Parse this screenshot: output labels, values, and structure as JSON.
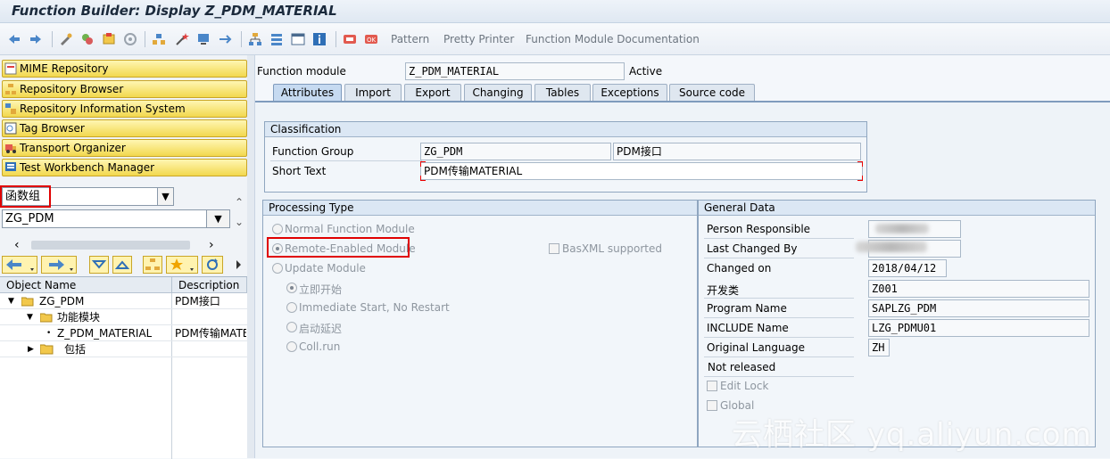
{
  "window": {
    "title": "Function Builder: Display Z_PDM_MATERIAL"
  },
  "toolbar": {
    "pattern_label": "Pattern",
    "pretty_printer_label": "Pretty Printer",
    "fm_docs_label": "Function Module Documentation"
  },
  "nav": {
    "buttons": [
      "MIME Repository",
      "Repository Browser",
      "Repository Information System",
      "Tag Browser",
      "Transport Organizer",
      "Test Workbench Manager"
    ],
    "object_type": "函数组",
    "object_name": "ZG_PDM"
  },
  "tree": {
    "col_object": "Object Name",
    "col_description": "Description",
    "rows": [
      {
        "name": "ZG_PDM",
        "desc": "PDM接口"
      },
      {
        "name": "功能模块",
        "desc": ""
      },
      {
        "name": "Z_PDM_MATERIAL",
        "desc": "PDM传输MATER"
      },
      {
        "name": "包括",
        "desc": ""
      }
    ]
  },
  "header": {
    "fm_label": "Function module",
    "fm_value": "Z_PDM_MATERIAL",
    "status": "Active"
  },
  "tabs": [
    "Attributes",
    "Import",
    "Export",
    "Changing",
    "Tables",
    "Exceptions",
    "Source code"
  ],
  "classification": {
    "title": "Classification",
    "fg_label": "Function Group",
    "fg_value": "ZG_PDM",
    "fg_desc": "PDM接口",
    "short_label": "Short Text",
    "short_value": "PDM传输MATERIAL"
  },
  "processing": {
    "title": "Processing Type",
    "normal": "Normal Function Module",
    "remote": "Remote-Enabled Module",
    "basxml": "BasXML supported",
    "update": "Update Module",
    "sub1": "立即开始",
    "sub2": "Immediate Start, No Restart",
    "sub3": "启动延迟",
    "sub4": "Coll.run"
  },
  "general": {
    "title": "General Data",
    "person_label": "Person Responsible",
    "changed_by_label": "Last Changed By",
    "changed_on_label": "Changed on",
    "changed_on_value": "2018/04/12",
    "devclass_label": "开发类",
    "devclass_value": "Z001",
    "program_label": "Program Name",
    "program_value": "SAPLZG_PDM",
    "include_label": "INCLUDE Name",
    "include_value": "LZG_PDMU01",
    "lang_label": "Original Language",
    "lang_value": "ZH",
    "not_released": "Not released",
    "edit_lock": "Edit Lock",
    "global": "Global"
  },
  "watermark": "云栖社区 yq.aliyun.com"
}
